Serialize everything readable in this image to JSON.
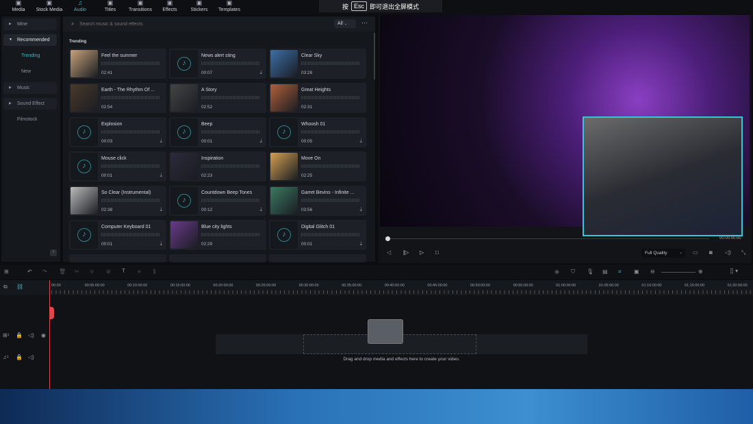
{
  "top_tabs": [
    {
      "label": "Media",
      "icon": "media-icon"
    },
    {
      "label": "Stock Media",
      "icon": "stock-icon"
    },
    {
      "label": "Audio",
      "icon": "music-note-icon"
    },
    {
      "label": "Titles",
      "icon": "titles-icon"
    },
    {
      "label": "Transitions",
      "icon": "transitions-icon"
    },
    {
      "label": "Effects",
      "icon": "effects-icon"
    },
    {
      "label": "Stickers",
      "icon": "stickers-icon"
    },
    {
      "label": "Templates",
      "icon": "templates-icon"
    }
  ],
  "active_tab": "Audio",
  "fullscreen_hint": {
    "before": "按",
    "key": "Esc",
    "after": "即可退出全屏模式"
  },
  "sidebar": {
    "items": [
      {
        "label": "Mine",
        "type": "group"
      },
      {
        "label": "Recommended",
        "type": "group-open"
      },
      {
        "label": "Trending",
        "type": "sub-active"
      },
      {
        "label": "New",
        "type": "sub"
      },
      {
        "label": "Music",
        "type": "group"
      },
      {
        "label": "Sound Effect",
        "type": "group"
      },
      {
        "label": "Filmstock",
        "type": "plain"
      }
    ]
  },
  "search": {
    "placeholder": "Search music & sound effects",
    "filter": "All"
  },
  "section_title": "Trending",
  "tracks": [
    {
      "title": "Feel the summer",
      "duration": "02:41",
      "thumb": "image"
    },
    {
      "title": "News alert sting",
      "duration": "00:07",
      "thumb": "note",
      "download": true
    },
    {
      "title": "Clear Sky",
      "duration": "03:28",
      "thumb": "image"
    },
    {
      "title": "Earth - The Rhythm Of ...",
      "duration": "02:54",
      "thumb": "image"
    },
    {
      "title": "A Story",
      "duration": "02:52",
      "thumb": "image"
    },
    {
      "title": "Great Heights",
      "duration": "02:31",
      "thumb": "image"
    },
    {
      "title": "Explosion",
      "duration": "00:03",
      "thumb": "note",
      "download": true
    },
    {
      "title": "Beep",
      "duration": "00:01",
      "thumb": "note",
      "download": true
    },
    {
      "title": "Whoosh 01",
      "duration": "00:05",
      "thumb": "note",
      "download": true
    },
    {
      "title": "Mouse click",
      "duration": "00:01",
      "thumb": "note",
      "download": true
    },
    {
      "title": "Inspiration",
      "duration": "02:23",
      "thumb": "image"
    },
    {
      "title": "Move On",
      "duration": "02:25",
      "thumb": "image"
    },
    {
      "title": "So Clear (Instrumental)",
      "duration": "02:38",
      "thumb": "image",
      "download": true
    },
    {
      "title": "Countdown Beep Tones",
      "duration": "00:12",
      "thumb": "note",
      "download": true
    },
    {
      "title": "Garret Bevins - Infinite ...",
      "duration": "03:56",
      "thumb": "image",
      "download": true
    },
    {
      "title": "Computer Keyboard 01",
      "duration": "00:01",
      "thumb": "note",
      "download": true
    },
    {
      "title": "Blue city lights",
      "duration": "02:29",
      "thumb": "image"
    },
    {
      "title": "Digital Glitch 01",
      "duration": "00:01",
      "thumb": "note",
      "download": true
    }
  ],
  "player": {
    "timecode": "00:00:00:00",
    "quality": "Full Quality",
    "progress": 0
  },
  "ruler_ticks": [
    "00:00",
    "00:05:00:00",
    "00:10:00:00",
    "00:15:00:00",
    "00:20:00:00",
    "00:25:00:00",
    "00:30:00:00",
    "00:35:00:00",
    "00:40:00:00",
    "00:45:00:00",
    "00:50:00:00",
    "00:55:00:00",
    "01:00:00:00",
    "01:05:00:00",
    "01:10:00:00",
    "01:15:00:00",
    "01:20:00:00"
  ],
  "drop_hint": "Drag and drop media and effects here to create your video.",
  "colors": {
    "accent": "#3fb8c8",
    "playhead": "#e0474c"
  }
}
